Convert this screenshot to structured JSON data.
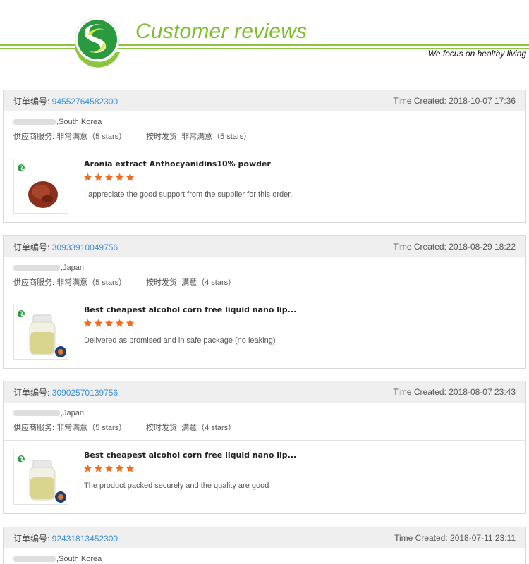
{
  "header": {
    "title": "Customer reviews",
    "tagline": "We focus on healthy living",
    "accent_color": "#8cc63f",
    "logo_icon": "s-leaf-logo-icon"
  },
  "labels": {
    "order_no": "订单编号: ",
    "time_created": "Time Created: ",
    "supplier_service": "供应商服务: ",
    "on_time_delivery": "按时发货: "
  },
  "reviews": [
    {
      "order_no": "94552764582300",
      "time": "2018-10-07 17:36",
      "buyer_country": ",South Korea",
      "service": "非常满意（5 stars）",
      "delivery": "非常满意（5 stars）",
      "product_title": "Aronia extract Anthocyanidins10% powder",
      "rating": 5,
      "comment": "I appreciate the good support from the supplier for this order.",
      "thumb": "powder"
    },
    {
      "order_no": "30933910049756",
      "time": "2018-08-29 18:22",
      "buyer_country": ",Japan",
      "service": "非常满意（5 stars）",
      "delivery": "满意（4 stars）",
      "product_title": "Best cheapest alcohol corn free liquid nano lip...",
      "rating": 5,
      "comment": "Delivered as promised and in safe package (no leaking)",
      "thumb": "bottle"
    },
    {
      "order_no": "30902570139756",
      "time": "2018-08-07 23:43",
      "buyer_country": ",Japan",
      "service": "非常满意（5 stars）",
      "delivery": "满意（4 stars）",
      "product_title": "Best cheapest alcohol corn free liquid nano lip...",
      "rating": 5,
      "comment": "The product packed securely and the quality are good",
      "thumb": "bottle"
    },
    {
      "order_no": "92431813452300",
      "time": "2018-07-11 23:11",
      "buyer_country": ",South Korea"
    }
  ]
}
